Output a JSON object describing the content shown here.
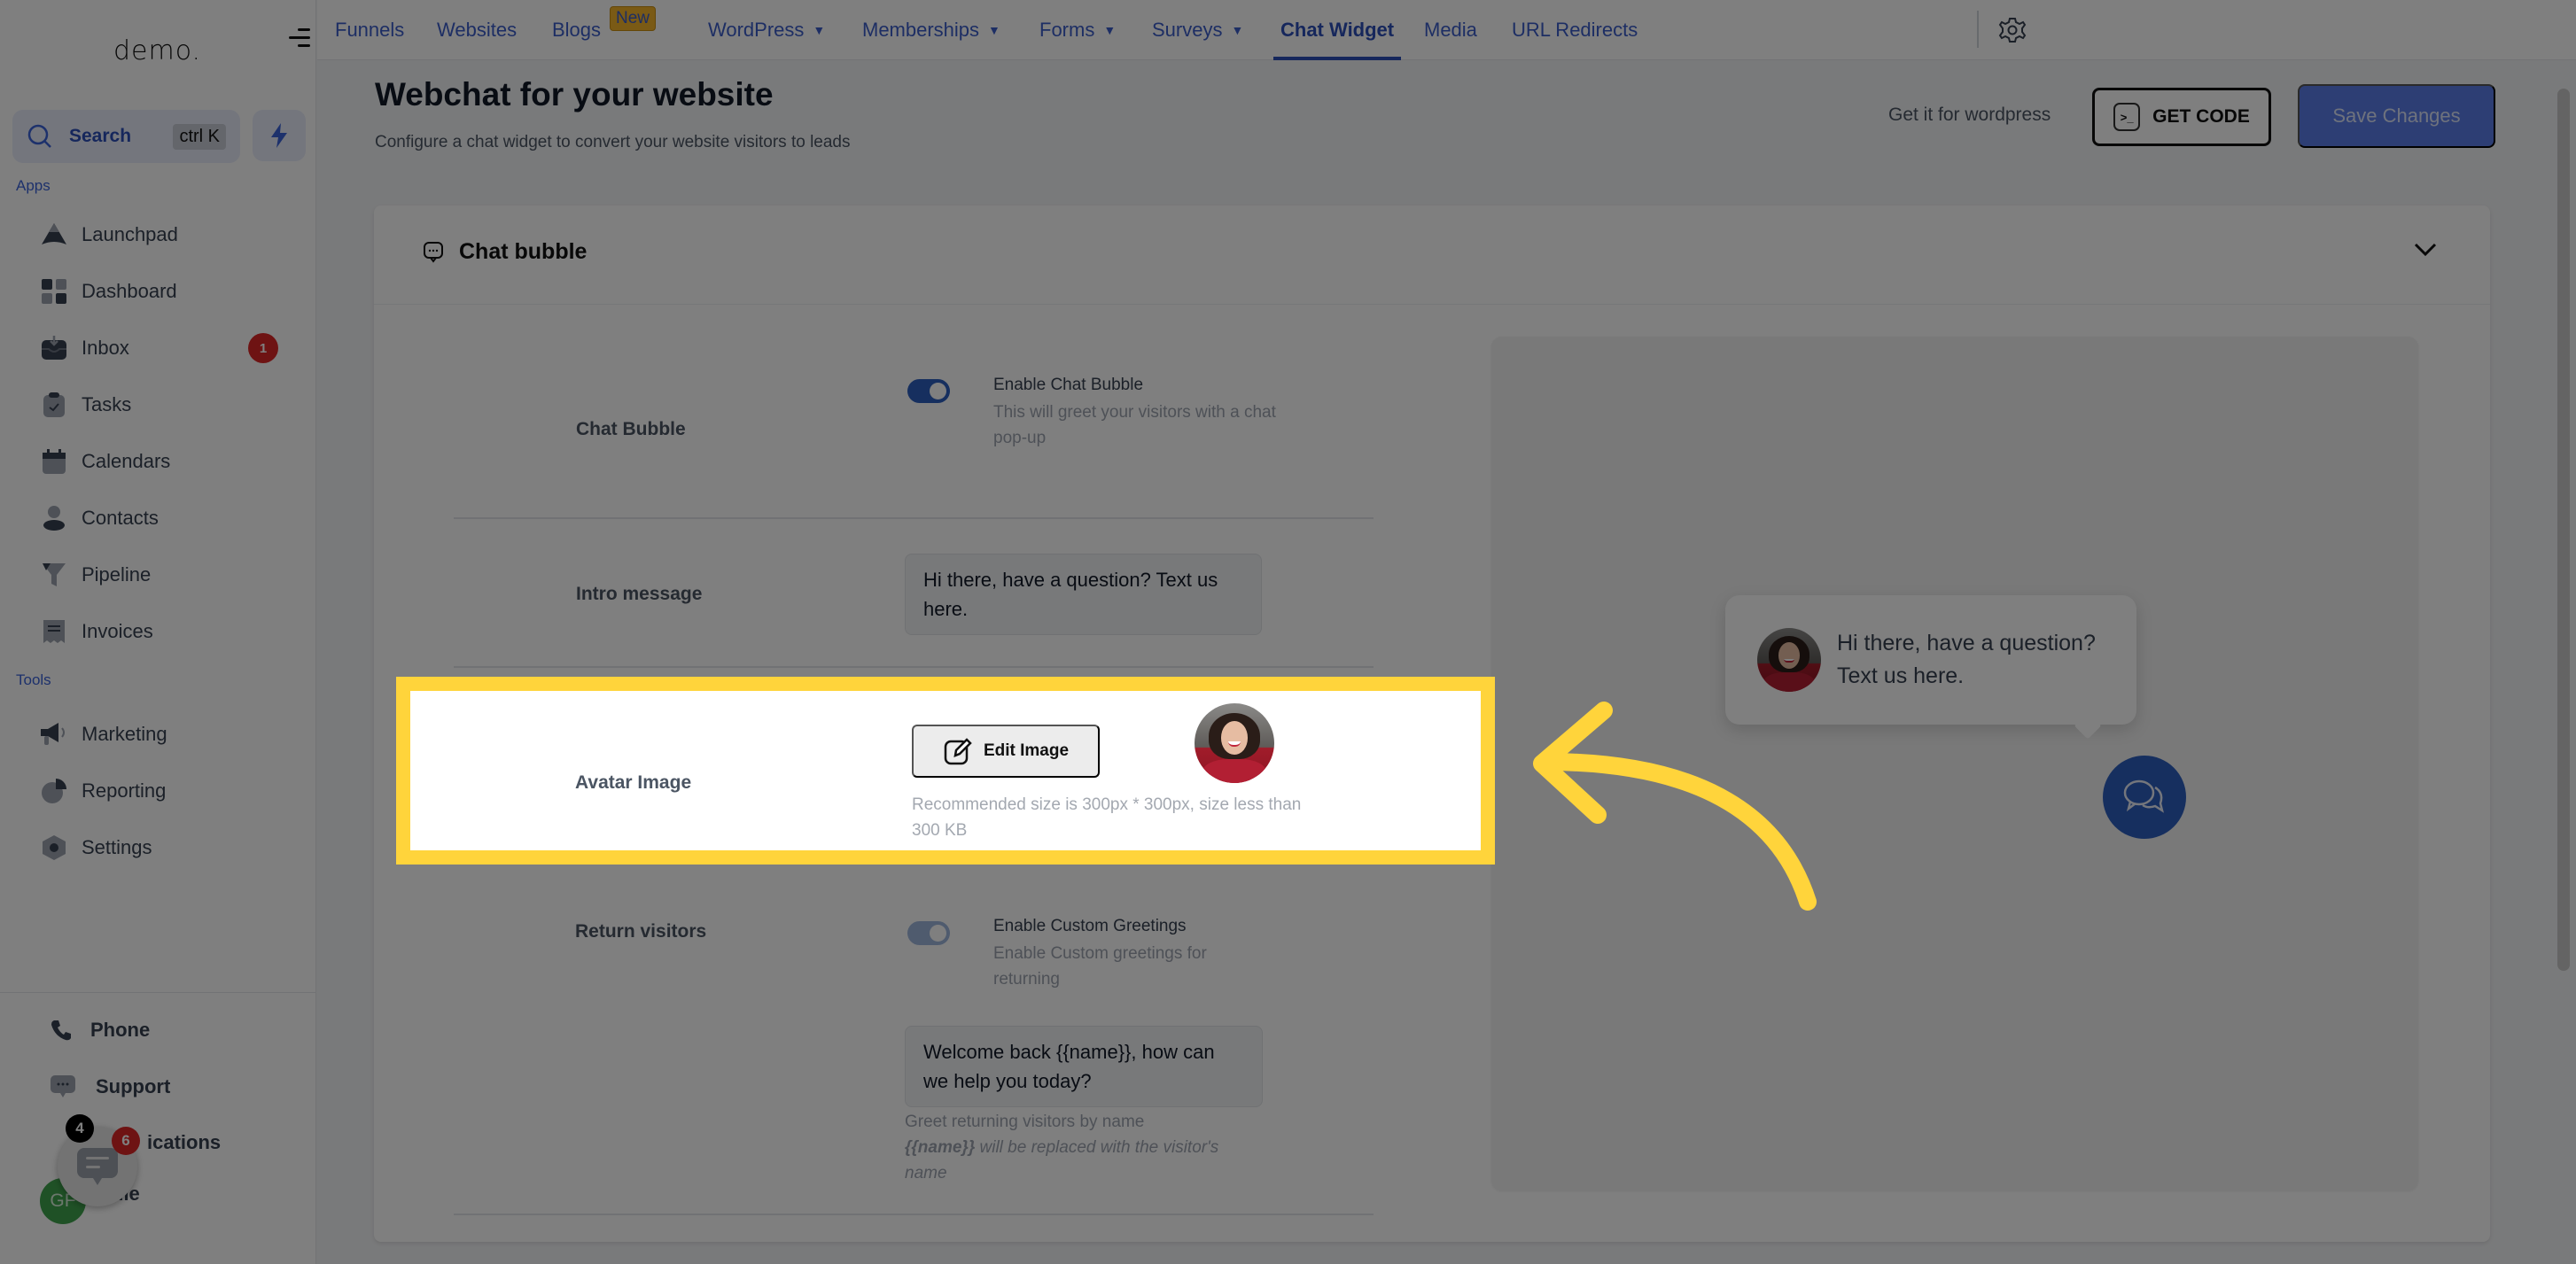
{
  "app": {
    "logo": "demo.",
    "search": {
      "label": "Search",
      "shortcut": "ctrl K"
    }
  },
  "sidebar": {
    "apps_label": "Apps",
    "apps": [
      {
        "label": "Launchpad",
        "icon": "launchpad-icon"
      },
      {
        "label": "Dashboard",
        "icon": "dashboard-icon"
      },
      {
        "label": "Inbox",
        "icon": "inbox-icon",
        "badge": "1"
      },
      {
        "label": "Tasks",
        "icon": "tasks-icon"
      },
      {
        "label": "Calendars",
        "icon": "calendar-icon"
      },
      {
        "label": "Contacts",
        "icon": "contacts-icon"
      },
      {
        "label": "Pipeline",
        "icon": "pipeline-icon"
      },
      {
        "label": "Invoices",
        "icon": "invoices-icon"
      }
    ],
    "tools_label": "Tools",
    "tools": [
      {
        "label": "Marketing",
        "icon": "megaphone-icon"
      },
      {
        "label": "Reporting",
        "icon": "pie-chart-icon"
      },
      {
        "label": "Settings",
        "icon": "gear-icon"
      }
    ],
    "bottom": {
      "phone": "Phone",
      "support": "Support",
      "notifications": "Notifications",
      "notifications_visible": "ications",
      "notifications_badge": "4",
      "profile": "Profile",
      "profile_visible": "file",
      "profile_initials": "GF"
    },
    "chat_widget_badge": "6"
  },
  "topnav": {
    "tabs": [
      {
        "label": "Funnels"
      },
      {
        "label": "Websites"
      },
      {
        "label": "Blogs",
        "badge": "New"
      },
      {
        "label": "WordPress",
        "dropdown": true
      },
      {
        "label": "Memberships",
        "dropdown": true
      },
      {
        "label": "Forms",
        "dropdown": true
      },
      {
        "label": "Surveys",
        "dropdown": true
      },
      {
        "label": "Chat Widget",
        "active": true
      },
      {
        "label": "Media"
      },
      {
        "label": "URL Redirects"
      }
    ]
  },
  "header": {
    "title": "Webchat for your website",
    "subtitle": "Configure a chat widget to convert your website visitors to leads",
    "wordpress_link": "Get it for wordpress",
    "get_code": "GET CODE",
    "save": "Save Changes"
  },
  "section": {
    "title": "Chat bubble",
    "rows": {
      "chat_bubble": {
        "label": "Chat Bubble",
        "toggle_on": true,
        "toggle_title": "Enable Chat Bubble",
        "toggle_desc": "This will greet your visitors with a chat pop-up"
      },
      "intro": {
        "label": "Intro message",
        "value": "Hi there, have a question? Text us here."
      },
      "avatar": {
        "label": "Avatar Image",
        "button": "Edit Image",
        "hint": "Recommended size is 300px * 300px, size less than 300 KB"
      },
      "return": {
        "label": "Return visitors",
        "toggle_on": true,
        "toggle_title": "Enable Custom Greetings",
        "toggle_desc": "Enable Custom greetings for returning",
        "value": "Welcome back {{name}}, how can we help you today?",
        "hint_line": "Greet returning visitors by name",
        "hint_var": "{{name}}",
        "hint_rest": " will be replaced with the visitor's name"
      }
    }
  },
  "preview": {
    "message": "Hi there, have a question? Text us here."
  },
  "colors": {
    "accent": "#2c5fbf",
    "highlight": "#ffd43b",
    "badge": "#dc2626"
  }
}
